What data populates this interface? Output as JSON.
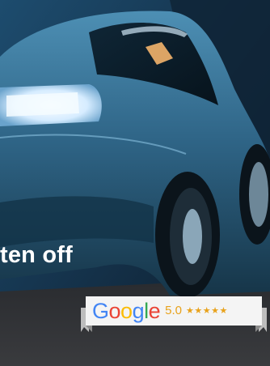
{
  "hero": {
    "headline": "ten off",
    "image": "blue-electric-car-rear"
  },
  "rating_badge": {
    "brand_letters": [
      "G",
      "o",
      "o",
      "g",
      "l",
      "e"
    ],
    "score": "5.0",
    "stars": "★★★★★",
    "rating_value": 5,
    "colors": {
      "blue": "#4285f4",
      "red": "#ea4335",
      "yellow": "#fbbc05",
      "green": "#34a853",
      "gold": "#e8a21b"
    }
  }
}
